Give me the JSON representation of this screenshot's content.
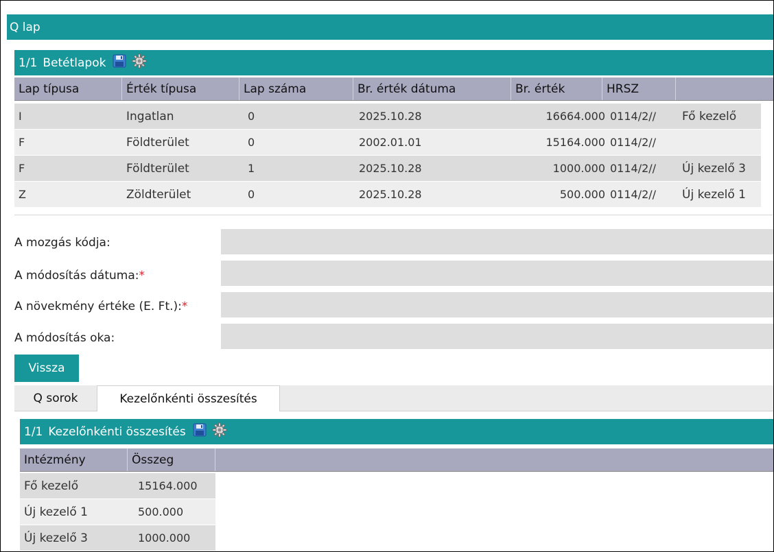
{
  "window": {
    "title": "Q lap"
  },
  "betetlapok": {
    "counter": "1/1",
    "title": "Betétlapok",
    "columns": [
      "Lap típusa",
      "Érték típusa",
      "Lap száma",
      "Br. érték dátuma",
      "Br. érték",
      "HRSZ"
    ],
    "rows": [
      {
        "lap_tipusa": "I",
        "ertek_tipusa": "Ingatlan",
        "lap_szama": "0",
        "datum": "2025.10.28",
        "ertek": "16664.000",
        "hrsz": "0114/2//",
        "kezelo": "Fő kezelő"
      },
      {
        "lap_tipusa": "F",
        "ertek_tipusa": "Földterület",
        "lap_szama": "0",
        "datum": "2002.01.01",
        "ertek": "15164.000",
        "hrsz": "0114/2//",
        "kezelo": ""
      },
      {
        "lap_tipusa": "F",
        "ertek_tipusa": "Földterület",
        "lap_szama": "1",
        "datum": "2025.10.28",
        "ertek": "1000.000",
        "hrsz": "0114/2//",
        "kezelo": "Új kezelő 3"
      },
      {
        "lap_tipusa": "Z",
        "ertek_tipusa": "Zöldterület",
        "lap_szama": "0",
        "datum": "2025.10.28",
        "ertek": "500.000",
        "hrsz": "0114/2//",
        "kezelo": "Új kezelő 1"
      }
    ]
  },
  "form": {
    "mozgas_kodja_label": "A mozgás kódja:",
    "modositas_datuma_label": "A módosítás dátuma:",
    "novekmeny_label": "A növekmény értéke (E. Ft.):",
    "modositas_oka_label": "A módosítás oka:",
    "required_mark": "*",
    "mozgas_kodja_value": "",
    "modositas_datuma_value": "",
    "novekmeny_value": "",
    "modositas_oka_value": ""
  },
  "back_button": "Vissza",
  "tabs": [
    {
      "label": "Q sorok"
    },
    {
      "label": "Kezelőnkénti összesítés"
    }
  ],
  "osszesites": {
    "counter": "1/1",
    "title": "Kezelőnkénti összesítés",
    "columns": [
      "Intézmény",
      "Összeg"
    ],
    "rows": [
      {
        "intezmeny": "Fő kezelő",
        "osszeg": "15164.000"
      },
      {
        "intezmeny": "Új kezelő 1",
        "osszeg": "500.000"
      },
      {
        "intezmeny": "Új kezelő 3",
        "osszeg": "1000.000"
      }
    ]
  },
  "colors": {
    "accent": "#17979a",
    "header": "#a8a9bf",
    "row_dark": "#dcdcdc",
    "row_light": "#eeeeee",
    "required": "#d9232d"
  },
  "icons": [
    "save-icon",
    "gear-icon"
  ]
}
